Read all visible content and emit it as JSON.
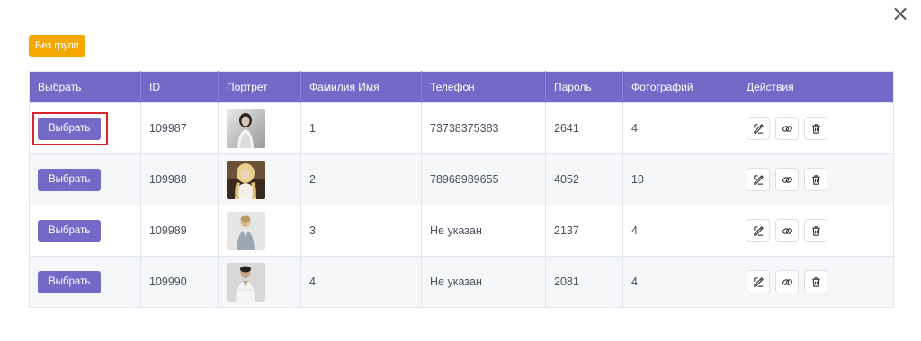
{
  "dialog": {
    "close_symbol": "×"
  },
  "group_button": {
    "label": "Без групп",
    "color": "#f5a800"
  },
  "accent_color": "#7569c8",
  "table": {
    "headers": [
      "Выбрать",
      "ID",
      "Портрет",
      "Фамилия Имя",
      "Телефон",
      "Пароль",
      "Фотографий",
      "Действия"
    ],
    "rows": [
      {
        "select_label": "Выбрать",
        "id": "109987",
        "portrait": "woman-dark-hair-portrait",
        "name": "1",
        "phone": "73738375383",
        "password": "2641",
        "photos": "4",
        "highlighted": true
      },
      {
        "select_label": "Выбрать",
        "id": "109988",
        "portrait": "woman-blonde-portrait",
        "name": "2",
        "phone": "78968989655",
        "password": "4052",
        "photos": "10",
        "highlighted": false
      },
      {
        "select_label": "Выбрать",
        "id": "109989",
        "portrait": "man-light-shirt-portrait",
        "name": "3",
        "phone": "Не указан",
        "password": "2137",
        "photos": "4",
        "highlighted": false
      },
      {
        "select_label": "Выбрать",
        "id": "109990",
        "portrait": "man-white-shirt-portrait",
        "name": "4",
        "phone": "Не указан",
        "password": "2081",
        "photos": "4",
        "highlighted": false
      }
    ],
    "action_icons": [
      "edit-icon",
      "link-icon",
      "trash-icon"
    ]
  }
}
